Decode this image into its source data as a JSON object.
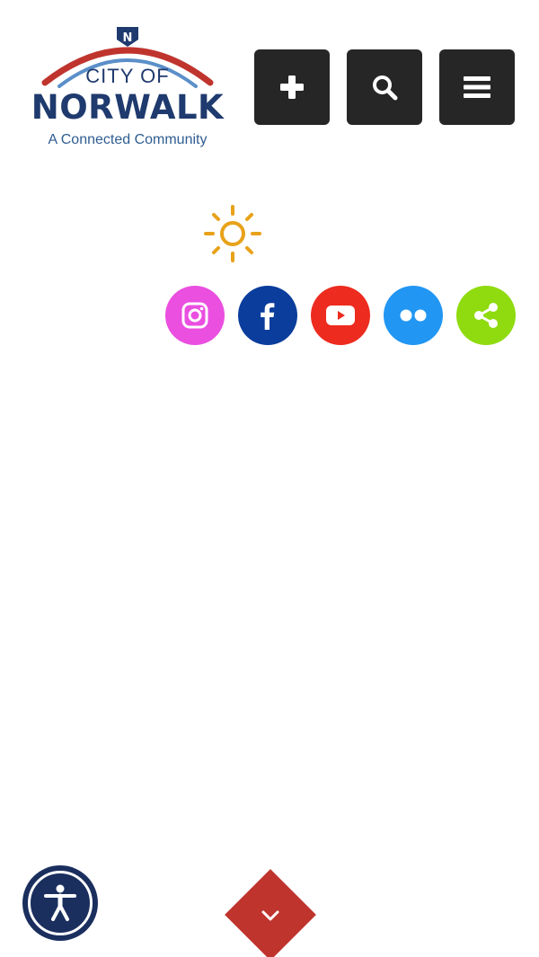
{
  "logo": {
    "badge_letter": "N",
    "city_of": "CITY OF",
    "name": "NORWALK",
    "tagline": "A Connected Community"
  },
  "header": {
    "buttons": [
      {
        "name": "add-button",
        "icon": "plus-icon"
      },
      {
        "name": "search-button",
        "icon": "search-icon"
      },
      {
        "name": "menu-button",
        "icon": "hamburger-icon"
      }
    ]
  },
  "weather": {
    "icon": "sun-icon",
    "color": "#e8a21a"
  },
  "social": [
    {
      "name": "instagram",
      "icon": "instagram-icon",
      "color": "#ea4fe0"
    },
    {
      "name": "facebook",
      "icon": "facebook-icon",
      "color": "#0a3d9c"
    },
    {
      "name": "youtube",
      "icon": "youtube-icon",
      "color": "#ed2b1f"
    },
    {
      "name": "flickr",
      "icon": "flickr-icon",
      "color": "#2196f3"
    },
    {
      "name": "share",
      "icon": "share-icon",
      "color": "#8fdb10"
    }
  ],
  "colors": {
    "header_button_bg": "#262626",
    "brand_navy": "#1f3a6e",
    "brand_red": "#c0342e",
    "accessibility_bg": "#1b2f5e"
  }
}
